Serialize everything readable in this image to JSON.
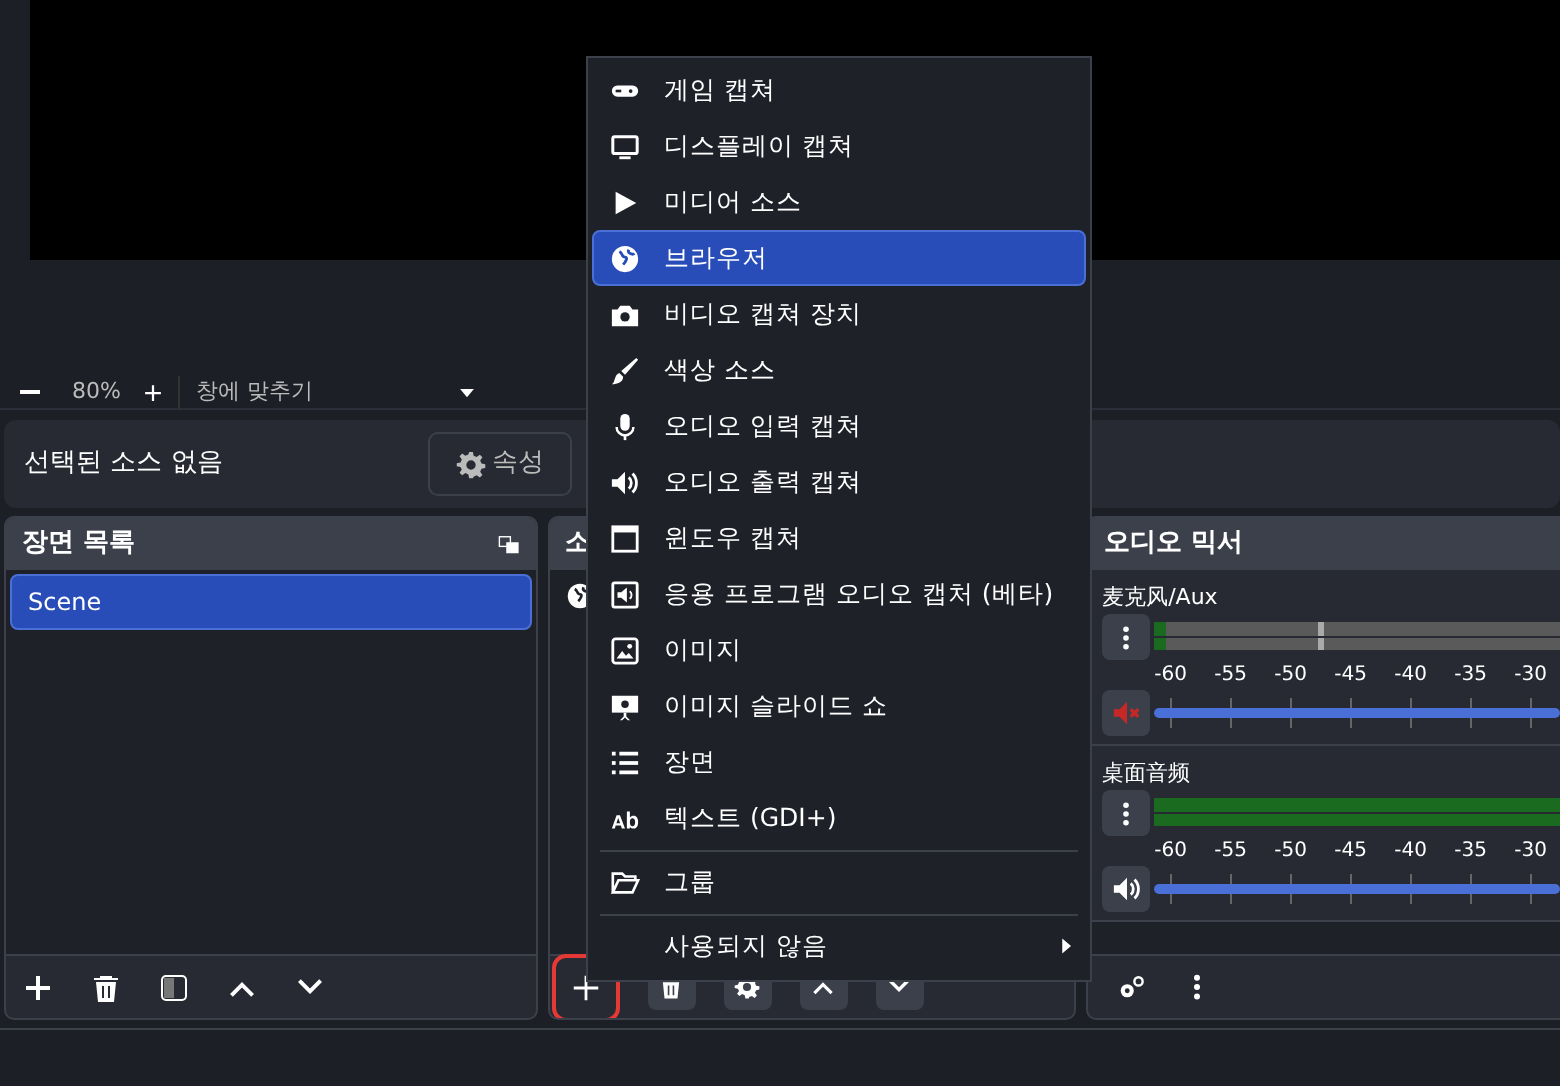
{
  "zoom_bar": {
    "zoom": "80%",
    "fit": "창에 맞추기"
  },
  "properties_bar": {
    "message": "선택된 소스 없음",
    "button": "속성"
  },
  "scenes": {
    "title": "장면 목록",
    "items": [
      {
        "label": "Scene",
        "selected": true
      }
    ]
  },
  "sources": {
    "title": "소",
    "add_highlighted": true
  },
  "mixer": {
    "title": "오디오 믹서",
    "channels": [
      {
        "name": "麦克风/Aux",
        "muted": true,
        "meter": {
          "level": 0.03
        },
        "fader": {
          "level": 1
        },
        "scale": [
          "-60",
          "-55",
          "-50",
          "-45",
          "-40",
          "-35",
          "-30"
        ]
      },
      {
        "name": "桌面音频",
        "muted": false,
        "meter": {
          "level": 1
        },
        "fader": {
          "level": 1
        },
        "scale": [
          "-60",
          "-55",
          "-50",
          "-45",
          "-40",
          "-35",
          "-30"
        ]
      }
    ]
  },
  "menu": {
    "items": [
      {
        "kind": "item",
        "label": "게임 캡쳐",
        "selected": false
      },
      {
        "kind": "item",
        "label": "디스플레이 캡쳐",
        "selected": false
      },
      {
        "kind": "item",
        "label": "미디어 소스",
        "selected": false
      },
      {
        "kind": "item",
        "label": "브라우저",
        "selected": true
      },
      {
        "kind": "item",
        "label": "비디오 캡쳐 장치",
        "selected": false
      },
      {
        "kind": "item",
        "label": "색상 소스",
        "selected": false
      },
      {
        "kind": "item",
        "label": "오디오 입력 캡쳐",
        "selected": false
      },
      {
        "kind": "item",
        "label": "오디오 출력 캡쳐",
        "selected": false
      },
      {
        "kind": "item",
        "label": "윈도우 캡쳐",
        "selected": false
      },
      {
        "kind": "item",
        "label": "응용 프로그램 오디오 캡처 (베타)",
        "selected": false
      },
      {
        "kind": "item",
        "label": "이미지",
        "selected": false
      },
      {
        "kind": "item",
        "label": "이미지 슬라이드 쇼",
        "selected": false
      },
      {
        "kind": "item",
        "label": "장면",
        "selected": false
      },
      {
        "kind": "item",
        "label": "텍스트 (GDI+)",
        "selected": false
      },
      {
        "kind": "separator"
      },
      {
        "kind": "item",
        "label": "그룹",
        "selected": false
      },
      {
        "kind": "separator"
      },
      {
        "kind": "submenu",
        "label": "사용되지 않음",
        "selected": false
      }
    ]
  }
}
